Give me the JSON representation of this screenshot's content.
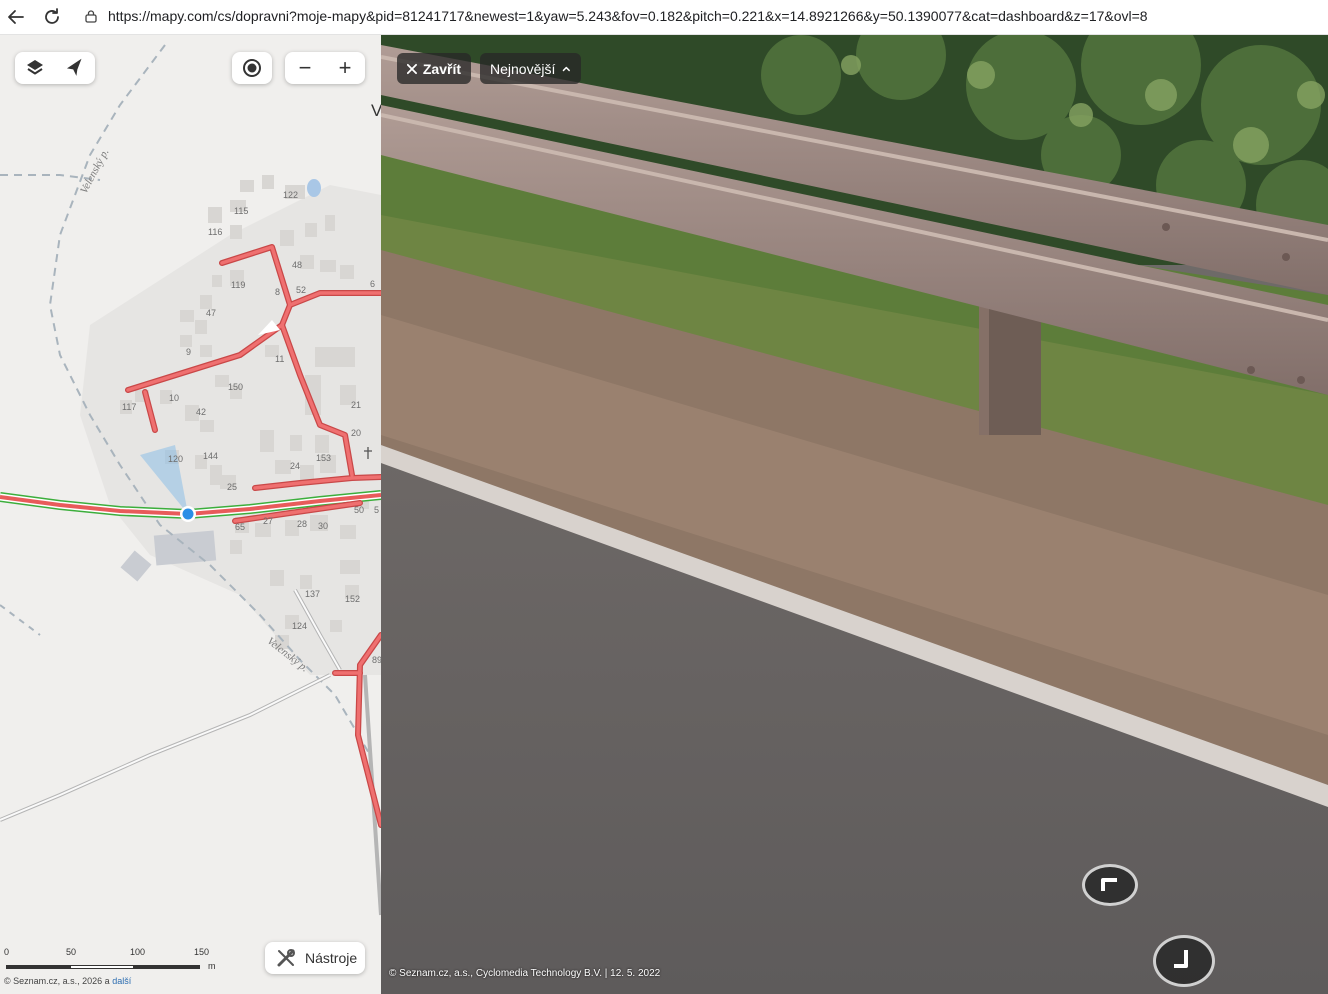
{
  "browser": {
    "url": "https://mapy.com/cs/dopravni?moje-mapy&pid=81241717&newest=1&yaw=5.243&fov=0.182&pitch=0.221&x=14.8921266&y=50.1390077&cat=dashboard&z=17&ovl=8",
    "back_icon": "arrow-left-icon",
    "reload_icon": "reload-icon",
    "site_icon": "page-info-icon"
  },
  "map": {
    "controls": {
      "layers_icon": "layers-icon",
      "flight_icon": "airplane-icon",
      "locate_icon": "target-icon",
      "zoom_out_label": "−",
      "zoom_in_label": "+"
    },
    "partial_label": "V",
    "stream_labels": [
      "Velenský p.",
      "Velenský p."
    ],
    "house_numbers": [
      "122",
      "115",
      "116",
      "48",
      "119",
      "8",
      "52",
      "6",
      "47",
      "9",
      "11",
      "150",
      "117",
      "10",
      "42",
      "21",
      "20",
      "120",
      "144",
      "24",
      "153",
      "25",
      "50",
      "5",
      "65",
      "27",
      "28",
      "30",
      "137",
      "152",
      "124",
      "89"
    ],
    "tools_label": "Nástroje",
    "tools_icon": "tools-icon",
    "scale": {
      "ticks": [
        "0",
        "50",
        "100",
        "150"
      ],
      "unit": "m"
    },
    "copyright": "© Seznam.cz, a.s., 2026 a",
    "copyright_link": "další"
  },
  "panorama": {
    "close_label": "Zavřít",
    "newest_label": "Nejnovější",
    "credit": "© Seznam.cz, a.s., Cyclomedia Technology B.V. | 12. 5. 2022",
    "nav_arrows": [
      "pano-arrow-icon",
      "pano-arrow-icon"
    ]
  },
  "colors": {
    "road_traffic": "#e85b5b",
    "route_green": "#3cae3c",
    "map_bg": "#f0efed",
    "panel_button": "#2b2b2b"
  }
}
